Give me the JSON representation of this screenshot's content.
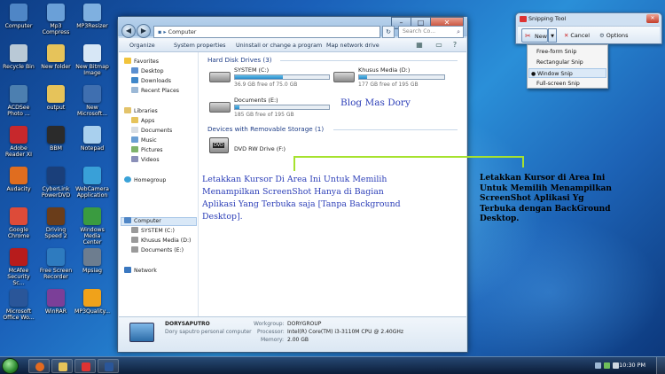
{
  "desktop_icons": [
    {
      "name": "computer",
      "label": "Computer",
      "color": "#4f86c6"
    },
    {
      "name": "mp3-compress",
      "label": "Mp3 Compress",
      "color": "#6aa0d8"
    },
    {
      "name": "mp3resizer",
      "label": "MP3Resizer",
      "color": "#7fb0e0"
    },
    {
      "name": "recycle-bin",
      "label": "Recycle Bin",
      "color": "#b9c9d6"
    },
    {
      "name": "new-folder",
      "label": "New folder",
      "color": "#e6c35a"
    },
    {
      "name": "new-bitmap-image",
      "label": "New Bitmap Image",
      "color": "#d7e7f6"
    },
    {
      "name": "acdsee",
      "label": "ACDSee Photo ...",
      "color": "#4c7fb0"
    },
    {
      "name": "output",
      "label": "output",
      "color": "#e6c35a"
    },
    {
      "name": "new-microsoft",
      "label": "New Microsoft...",
      "color": "#3f6fb0"
    },
    {
      "name": "adobe-reader",
      "label": "Adobe Reader XI",
      "color": "#c7282c"
    },
    {
      "name": "bbm",
      "label": "BBM",
      "color": "#2b2b2b"
    },
    {
      "name": "notepad",
      "label": "Notepad",
      "color": "#a9d0ee"
    },
    {
      "name": "audacity",
      "label": "Audacity",
      "color": "#e06d1f"
    },
    {
      "name": "cyberlink",
      "label": "CyberLink PowerDVD",
      "color": "#1a3f7a"
    },
    {
      "name": "webcamera",
      "label": "WebCamera Application",
      "color": "#39a0d8"
    },
    {
      "name": "google-chrome",
      "label": "Google Chrome",
      "color": "#dd4b39"
    },
    {
      "name": "driving-speed",
      "label": "Driving Speed 2",
      "color": "#6a3d1a"
    },
    {
      "name": "windows-media-center",
      "label": "Windows Media Center",
      "color": "#3a9b40"
    },
    {
      "name": "mcafee",
      "label": "McAfee Security Sc...",
      "color": "#b71c1c"
    },
    {
      "name": "free-screen-recorder",
      "label": "Free Screen Recorder",
      "color": "#2e7bbf"
    },
    {
      "name": "mpsiag",
      "label": "Mpsiag",
      "color": "#6d7d8f"
    },
    {
      "name": "ms-office-word",
      "label": "Microsoft Office Wo...",
      "color": "#2a5699"
    },
    {
      "name": "winrar",
      "label": "WinRAR",
      "color": "#7b3f98"
    },
    {
      "name": "mp3quality",
      "label": "MP3Quality...",
      "color": "#f0a21a"
    }
  ],
  "explorer": {
    "address": "Computer",
    "search_placeholder": "Search Co...",
    "toolbar": {
      "organize": "Organize",
      "system_properties": "System properties",
      "uninstall": "Uninstall or change a program",
      "map_network": "Map network drive"
    },
    "nav": {
      "favorites": "Favorites",
      "desktop": "Desktop",
      "downloads": "Downloads",
      "recent_places": "Recent Places",
      "libraries": "Libraries",
      "apps": "Apps",
      "documents": "Documents",
      "music": "Music",
      "pictures": "Pictures",
      "videos": "Videos",
      "homegroup": "Homegroup",
      "computer": "Computer",
      "system_c": "SYSTEM (C:)",
      "khusus_d": "Khusus Media (D:)",
      "documents_e": "Documents (E:)",
      "network": "Network"
    },
    "hdd_group": "Hard Disk Drives (3)",
    "drives": [
      {
        "name": "SYSTEM (C:)",
        "free": "36.9 GB free of 75.0 GB",
        "used_fraction": 0.51
      },
      {
        "name": "Khusus Media (D:)",
        "free": "177 GB free of 195 GB",
        "used_fraction": 0.09
      },
      {
        "name": "Documents (E:)",
        "free": "185 GB free of 195 GB",
        "used_fraction": 0.05
      }
    ],
    "removable_group": "Devices with Removable Storage (1)",
    "dvd": {
      "name": "DVD RW Drive (F:)",
      "badge": "DVD"
    },
    "details": {
      "computer_name": "DORYSAPUTRO",
      "description": "Dory saputro personal computer",
      "workgroup_label": "Workgroup:",
      "workgroup": "DORYGROUP",
      "processor_label": "Processor:",
      "processor": "Intel(R) Core(TM) i3-3110M CPU @ 2.40GHz",
      "memory_label": "Memory:",
      "memory": "2.00 GB"
    }
  },
  "annotations": {
    "blog": "Blog Mas Dory",
    "left_lines": [
      "Letakkan Kursor Di Area Ini Untuk Memilih",
      "Menampilkan ScreenShot Hanya di Bagian",
      "Aplikasi Yang Terbuka saja [Tanpa Background",
      "Desktop]."
    ],
    "right_lines": [
      "Letakkan Kursor di Area Ini",
      "Untuk Memilih Menampilkan",
      "ScreenShot Aplikasi Yg",
      "Terbuka dengan BackGround",
      "Desktop."
    ]
  },
  "snipping_tool": {
    "title": "Snipping Tool",
    "new_label": "New",
    "cancel_label": "Cancel",
    "options_label": "Options",
    "menu": [
      "Free-form Snip",
      "Rectangular Snip",
      "Window Snip",
      "Full-screen Snip"
    ],
    "selected_index": 2
  },
  "taskbar": {
    "clock": "10:30 PM"
  }
}
